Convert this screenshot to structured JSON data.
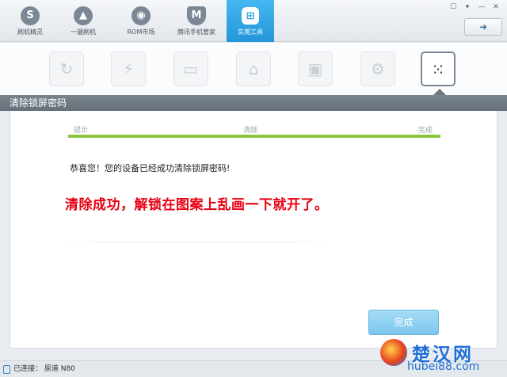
{
  "nav": {
    "items": [
      {
        "label": "刷机精灵",
        "icon": "s-logo-icon",
        "glyph": "S"
      },
      {
        "label": "一键刷机",
        "icon": "cursor-icon",
        "glyph": "▲"
      },
      {
        "label": "ROM市场",
        "icon": "android-icon",
        "glyph": "◉"
      },
      {
        "label": "腾讯手机管家",
        "icon": "shield-icon",
        "glyph": "M"
      },
      {
        "label": "实用工具",
        "icon": "tools-grid-icon",
        "glyph": "⊞"
      }
    ],
    "active_index": 4
  },
  "window": {
    "controls": [
      "☐",
      "▾",
      "—",
      "✕"
    ],
    "back_button": "➜"
  },
  "tools": {
    "items": [
      {
        "name": "refresh-icon",
        "glyph": "↻"
      },
      {
        "name": "flash-icon",
        "glyph": "⚡"
      },
      {
        "name": "tablet-icon",
        "glyph": "▭"
      },
      {
        "name": "android-box-icon",
        "glyph": "⌂"
      },
      {
        "name": "android-chip-icon",
        "glyph": "▣"
      },
      {
        "name": "gears-icon",
        "glyph": "⚙"
      },
      {
        "name": "pattern-lock-icon",
        "glyph": "⁙"
      }
    ],
    "active_index": 6
  },
  "section": {
    "title": "清除锁屏密码"
  },
  "progress": {
    "steps": [
      "提示",
      "清除",
      "完成"
    ],
    "fraction": 1.0,
    "color": "#8cc63f"
  },
  "message": "恭喜您！您的设备已经成功清除锁屏密码!",
  "annotation": "清除成功，解锁在图案上乱画一下就开了。",
  "done_button": "完成",
  "status": {
    "text": "已连接： 原道 N80"
  },
  "watermark": {
    "title": "楚汉网",
    "url": "hubei88.com"
  }
}
